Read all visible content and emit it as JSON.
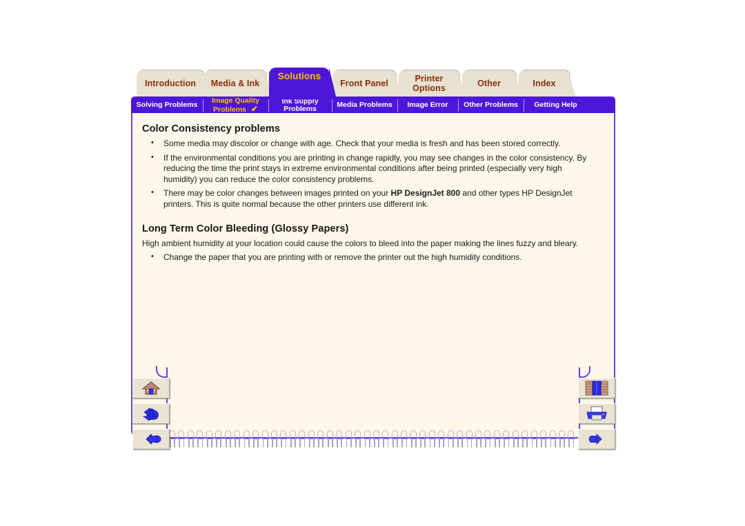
{
  "colors": {
    "accent_purple": "#4d16d8",
    "tab_cream": "#e7e1d0",
    "tab_text": "#8c2d08",
    "highlight_gold": "#ffc000",
    "page_cream": "#fdf6ea",
    "page_border": "#6c3fe0"
  },
  "tabs": [
    {
      "label": "Introduction",
      "active": false
    },
    {
      "label": "Media & Ink",
      "active": false
    },
    {
      "label": "Solutions",
      "active": true
    },
    {
      "label": "Front Panel",
      "active": false
    },
    {
      "label": "Printer Options",
      "line1": "Printer",
      "line2": "Options",
      "active": false
    },
    {
      "label": "Other",
      "active": false
    },
    {
      "label": "Index",
      "active": false
    }
  ],
  "subtabs": [
    {
      "label": "Solving Problems",
      "line1": "Solving Problems",
      "line2": "",
      "current": false,
      "check": ""
    },
    {
      "label": "Image Quality Problems",
      "line1": "Image Quality",
      "line2": "Problems",
      "current": true,
      "check": "✔"
    },
    {
      "label": "Ink Supply Problems",
      "line1": "Ink Supply",
      "line2": "Problems",
      "current": false,
      "check": ""
    },
    {
      "label": "Media Problems",
      "line1": "Media Problems",
      "line2": "",
      "current": false,
      "check": ""
    },
    {
      "label": "Image Error",
      "line1": "Image Error",
      "line2": "",
      "current": false,
      "check": ""
    },
    {
      "label": "Other Problems",
      "line1": "Other Problems",
      "line2": "",
      "current": false,
      "check": ""
    },
    {
      "label": "Getting Help",
      "line1": "Getting Help",
      "line2": "",
      "current": false,
      "check": ""
    }
  ],
  "content": {
    "section1": {
      "heading": "Color Consistency problems",
      "bullets": [
        "Some media may discolor or change with age. Check that your media is fresh and has been stored correctly.",
        "If the environmental conditions you are printing in change rapidly, you may see changes in the color consistency. By reducing the time the print stays in extreme environmental conditions after being printed (especially very high humidity) you can reduce the color consistency problems."
      ],
      "bullet3_pre": "There may be color changes between images printed on your ",
      "bullet3_bold": "HP DesignJet 800",
      "bullet3_post": " and other types HP DesignJet printers. This is quite normal because the other printers use different ink."
    },
    "section2": {
      "heading": "Long Term Color Bleeding (Glossy Papers)",
      "paragraph": "High ambient humidity at your location could cause the colors to bleed into the paper making the lines fuzzy and bleary.",
      "bullets": [
        "Change the paper that you are printing with or remove the printer out the high humidity conditions."
      ]
    }
  },
  "nav_left": [
    {
      "icon": "home-icon",
      "title": "Home"
    },
    {
      "icon": "back-arrow-icon",
      "title": "Back"
    },
    {
      "icon": "hand-pointer-left-icon",
      "title": "Previous page"
    }
  ],
  "nav_right": [
    {
      "icon": "index-bookshelf-icon",
      "title": "Index"
    },
    {
      "icon": "printer-icon",
      "title": "Print"
    },
    {
      "icon": "hand-pointer-right-icon",
      "title": "Next page"
    }
  ],
  "spiral": {
    "ring_count": 44
  }
}
